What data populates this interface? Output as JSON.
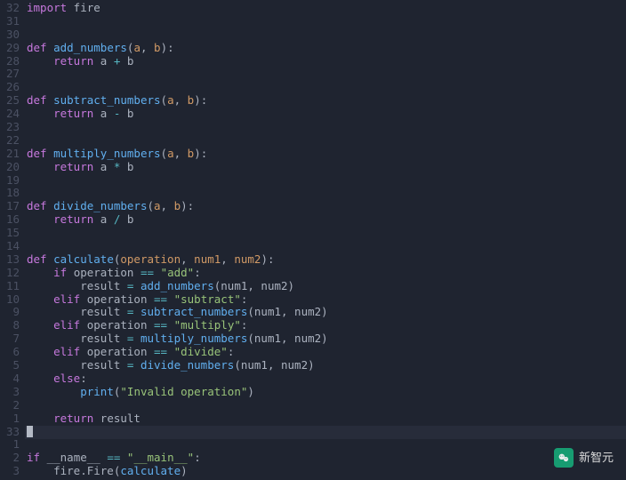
{
  "line_numbers": [
    "32",
    "31",
    "30",
    "29",
    "28",
    "27",
    "26",
    "25",
    "24",
    "23",
    "22",
    "21",
    "20",
    "19",
    "18",
    "17",
    "16",
    "15",
    "14",
    "13",
    "12",
    "11",
    "10",
    "9",
    "8",
    "7",
    "6",
    "5",
    "4",
    "3",
    "2",
    "1",
    "33",
    "1",
    "2",
    "3"
  ],
  "code_lines": [
    [
      [
        "kw",
        "import"
      ],
      [
        "ident",
        " fire"
      ]
    ],
    [],
    [],
    [
      [
        "kw",
        "def "
      ],
      [
        "fn",
        "add_numbers"
      ],
      [
        "punct",
        "("
      ],
      [
        "param",
        "a"
      ],
      [
        "punct",
        ", "
      ],
      [
        "param",
        "b"
      ],
      [
        "punct",
        "):"
      ]
    ],
    [
      [
        "ident",
        "    "
      ],
      [
        "kw",
        "return"
      ],
      [
        "ident",
        " a "
      ],
      [
        "op",
        "+"
      ],
      [
        "ident",
        " b"
      ]
    ],
    [],
    [],
    [
      [
        "kw",
        "def "
      ],
      [
        "fn",
        "subtract_numbers"
      ],
      [
        "punct",
        "("
      ],
      [
        "param",
        "a"
      ],
      [
        "punct",
        ", "
      ],
      [
        "param",
        "b"
      ],
      [
        "punct",
        "):"
      ]
    ],
    [
      [
        "ident",
        "    "
      ],
      [
        "kw",
        "return"
      ],
      [
        "ident",
        " a "
      ],
      [
        "op",
        "-"
      ],
      [
        "ident",
        " b"
      ]
    ],
    [],
    [],
    [
      [
        "kw",
        "def "
      ],
      [
        "fn",
        "multiply_numbers"
      ],
      [
        "punct",
        "("
      ],
      [
        "param",
        "a"
      ],
      [
        "punct",
        ", "
      ],
      [
        "param",
        "b"
      ],
      [
        "punct",
        "):"
      ]
    ],
    [
      [
        "ident",
        "    "
      ],
      [
        "kw",
        "return"
      ],
      [
        "ident",
        " a "
      ],
      [
        "op",
        "*"
      ],
      [
        "ident",
        " b"
      ]
    ],
    [],
    [],
    [
      [
        "kw",
        "def "
      ],
      [
        "fn",
        "divide_numbers"
      ],
      [
        "punct",
        "("
      ],
      [
        "param",
        "a"
      ],
      [
        "punct",
        ", "
      ],
      [
        "param",
        "b"
      ],
      [
        "punct",
        "):"
      ]
    ],
    [
      [
        "ident",
        "    "
      ],
      [
        "kw",
        "return"
      ],
      [
        "ident",
        " a "
      ],
      [
        "op",
        "/"
      ],
      [
        "ident",
        " b"
      ]
    ],
    [],
    [],
    [
      [
        "kw",
        "def "
      ],
      [
        "fn",
        "calculate"
      ],
      [
        "punct",
        "("
      ],
      [
        "param",
        "operation"
      ],
      [
        "punct",
        ", "
      ],
      [
        "param",
        "num1"
      ],
      [
        "punct",
        ", "
      ],
      [
        "param",
        "num2"
      ],
      [
        "punct",
        "):"
      ]
    ],
    [
      [
        "ident",
        "    "
      ],
      [
        "kw",
        "if"
      ],
      [
        "ident",
        " operation "
      ],
      [
        "op",
        "=="
      ],
      [
        "ident",
        " "
      ],
      [
        "str",
        "\"add\""
      ],
      [
        "punct",
        ":"
      ]
    ],
    [
      [
        "ident",
        "        result "
      ],
      [
        "op",
        "="
      ],
      [
        "ident",
        " "
      ],
      [
        "fn",
        "add_numbers"
      ],
      [
        "punct",
        "(num1, num2)"
      ]
    ],
    [
      [
        "ident",
        "    "
      ],
      [
        "kw",
        "elif"
      ],
      [
        "ident",
        " operation "
      ],
      [
        "op",
        "=="
      ],
      [
        "ident",
        " "
      ],
      [
        "str",
        "\"subtract\""
      ],
      [
        "punct",
        ":"
      ]
    ],
    [
      [
        "ident",
        "        result "
      ],
      [
        "op",
        "="
      ],
      [
        "ident",
        " "
      ],
      [
        "fn",
        "subtract_numbers"
      ],
      [
        "punct",
        "(num1, num2)"
      ]
    ],
    [
      [
        "ident",
        "    "
      ],
      [
        "kw",
        "elif"
      ],
      [
        "ident",
        " operation "
      ],
      [
        "op",
        "=="
      ],
      [
        "ident",
        " "
      ],
      [
        "str",
        "\"multiply\""
      ],
      [
        "punct",
        ":"
      ]
    ],
    [
      [
        "ident",
        "        result "
      ],
      [
        "op",
        "="
      ],
      [
        "ident",
        " "
      ],
      [
        "fn",
        "multiply_numbers"
      ],
      [
        "punct",
        "(num1, num2)"
      ]
    ],
    [
      [
        "ident",
        "    "
      ],
      [
        "kw",
        "elif"
      ],
      [
        "ident",
        " operation "
      ],
      [
        "op",
        "=="
      ],
      [
        "ident",
        " "
      ],
      [
        "str",
        "\"divide\""
      ],
      [
        "punct",
        ":"
      ]
    ],
    [
      [
        "ident",
        "        result "
      ],
      [
        "op",
        "="
      ],
      [
        "ident",
        " "
      ],
      [
        "fn",
        "divide_numbers"
      ],
      [
        "punct",
        "(num1, num2)"
      ]
    ],
    [
      [
        "ident",
        "    "
      ],
      [
        "kw",
        "else"
      ],
      [
        "punct",
        ":"
      ]
    ],
    [
      [
        "ident",
        "        "
      ],
      [
        "fn",
        "print"
      ],
      [
        "punct",
        "("
      ],
      [
        "str",
        "\"Invalid operation\""
      ],
      [
        "punct",
        ")"
      ]
    ],
    [],
    [
      [
        "ident",
        "    "
      ],
      [
        "kw",
        "return"
      ],
      [
        "ident",
        " result"
      ]
    ],
    [
      [
        "cursor",
        ""
      ]
    ],
    [],
    [
      [
        "kw",
        "if"
      ],
      [
        "ident",
        " __name__ "
      ],
      [
        "op",
        "=="
      ],
      [
        "ident",
        " "
      ],
      [
        "str",
        "\"__main__\""
      ],
      [
        "punct",
        ":"
      ]
    ],
    [
      [
        "ident",
        "    fire.Fire("
      ],
      [
        "fn",
        "calculate"
      ],
      [
        "punct",
        ")"
      ]
    ]
  ],
  "cursor_line_index": 32,
  "watermark_text": "新智元"
}
